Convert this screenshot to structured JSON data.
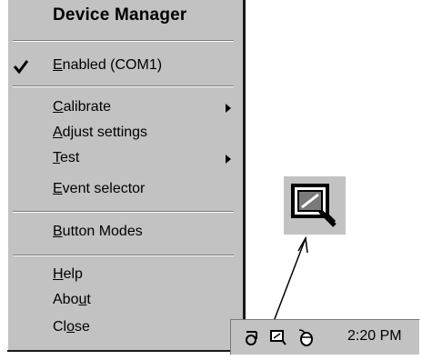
{
  "menu": {
    "title": "Device Manager",
    "enabled_pre": "",
    "enabled_key": "E",
    "enabled_rest": "nabled (COM1)",
    "items": [
      {
        "key": "C",
        "rest": "alibrate"
      },
      {
        "key": "A",
        "rest": "djust settings"
      },
      {
        "key": "T",
        "rest": "est"
      },
      {
        "key": "E",
        "rest": "vent selector"
      },
      {
        "key": "B",
        "rest": "utton Modes"
      },
      {
        "key": "H",
        "rest": "elp"
      },
      {
        "pre": "Abo",
        "key": "u",
        "rest": "t"
      },
      {
        "pre": "Cl",
        "key": "o",
        "rest": "se"
      }
    ]
  },
  "tray": {
    "time": "2:20 PM"
  },
  "icons": {
    "check": "checkmark-icon",
    "submenu": "submenu-arrow-icon",
    "tablet": "tablet-tray-icon",
    "speaker": "speaker-tray-icon",
    "mouse": "mouse-tray-icon",
    "zoom": "tablet-icon-zoomed"
  }
}
